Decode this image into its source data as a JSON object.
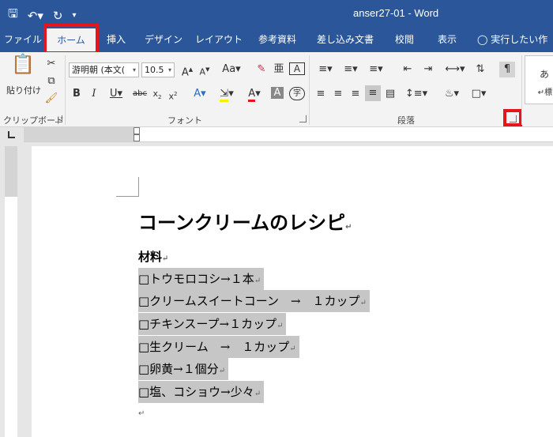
{
  "titlebar": {
    "document_title": "anser27-01 - Word"
  },
  "qat": {
    "save_icon": "save-icon",
    "undo_icon": "undo-icon",
    "redo_icon": "redo-icon",
    "customize_icon": "qat-customize-icon"
  },
  "tabs": [
    {
      "label": "ファイル"
    },
    {
      "label": "ホーム"
    },
    {
      "label": "挿入"
    },
    {
      "label": "デザイン"
    },
    {
      "label": "レイアウト"
    },
    {
      "label": "参考資料"
    },
    {
      "label": "差し込み文書"
    },
    {
      "label": "校閲"
    },
    {
      "label": "表示"
    },
    {
      "label": "実行したい作業"
    }
  ],
  "ribbon": {
    "clipboard": {
      "paste_label": "貼り付け",
      "group_label": "クリップボード"
    },
    "font": {
      "font_name": "游明朝 (本文(",
      "font_size": "10.5",
      "group_label": "フォント"
    },
    "paragraph": {
      "group_label": "段落"
    },
    "styles": {
      "preview_text": "あ",
      "preview_text2": "↵標"
    }
  },
  "document": {
    "heading": "コーンクリームのレシピ",
    "ingredients_label": "材料",
    "items": [
      "□トウモロコシ→１本",
      "□クリームスイートコーン　→　１カップ",
      "□チキンスープ→１カップ",
      "□生クリーム　→　１カップ",
      "□卵黄→１個分",
      "□塩、コショウ→少々"
    ],
    "return_mark": "↵"
  },
  "colors": {
    "word_blue": "#2b579a",
    "highlight_red": "#e8141b",
    "selection_gray": "#c6c6c6"
  }
}
